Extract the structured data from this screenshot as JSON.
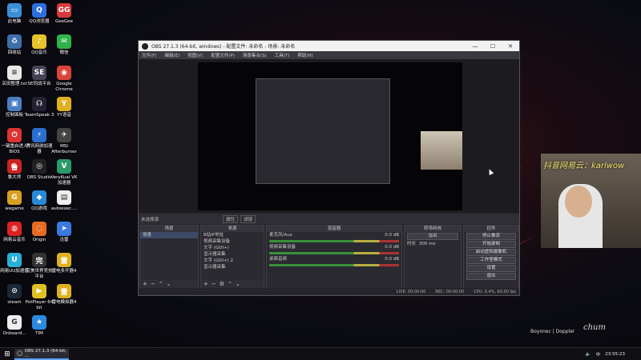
{
  "desktop": {
    "icons": [
      {
        "label": "此电脑",
        "glyph": "▭",
        "color": "#3b8fd9"
      },
      {
        "label": "QQ浏览器",
        "glyph": "Q",
        "color": "#2b6fe0"
      },
      {
        "label": "GeeGee",
        "glyph": "GG",
        "color": "#d93a3a"
      },
      {
        "label": "回收站",
        "glyph": "♻",
        "color": "#3d6fa8"
      },
      {
        "label": "QQ音乐",
        "glyph": "♪",
        "color": "#e6c22b"
      },
      {
        "label": "微信",
        "glyph": "✉",
        "color": "#2fb34a"
      },
      {
        "label": "买田整理.txt",
        "glyph": "≡",
        "color": "#e8e8e8"
      },
      {
        "label": "SE同战平台",
        "glyph": "SE",
        "color": "#445"
      },
      {
        "label": "Google Chrome",
        "glyph": "◉",
        "color": "#d9453a"
      },
      {
        "label": "控制面板",
        "glyph": "▣",
        "color": "#4a7ec2"
      },
      {
        "label": "TeamSpeak 3",
        "glyph": "☊",
        "color": "#223"
      },
      {
        "label": "YY语音",
        "glyph": "Y",
        "color": "#e0b020"
      },
      {
        "label": "一键重启进入BIOS",
        "glyph": "⏻",
        "color": "#d33"
      },
      {
        "label": "腾讯网游加速器",
        "glyph": "⚡",
        "color": "#2a6fd0"
      },
      {
        "label": "MSI Afterburner",
        "glyph": "✈",
        "color": "#444"
      },
      {
        "label": "鲁大师",
        "glyph": "鲁",
        "color": "#c22"
      },
      {
        "label": "OBS Studio",
        "glyph": "◎",
        "color": "#222"
      },
      {
        "label": "VeryKuai VK加速器",
        "glyph": "V",
        "color": "#2a9a6a"
      },
      {
        "label": "wegame",
        "glyph": "G",
        "color": "#d8a020"
      },
      {
        "label": "QQ游戏",
        "glyph": "◆",
        "color": "#2a8ad8"
      },
      {
        "label": "autoexec....",
        "glyph": "▤",
        "color": "#eee"
      },
      {
        "label": "网易云音乐",
        "glyph": "◍",
        "color": "#d22"
      },
      {
        "label": "Origin",
        "glyph": "◌",
        "color": "#e66a20"
      },
      {
        "label": "迅雷",
        "glyph": "➤",
        "color": "#3a7ae0"
      },
      {
        "label": "网易UU加速器",
        "glyph": "U",
        "color": "#2ab0d8"
      },
      {
        "label": "完美世界竞技平台",
        "glyph": "完",
        "color": "#333"
      },
      {
        "label": "雷电多开器4",
        "glyph": "雷",
        "color": "#e0b020"
      },
      {
        "label": "steam",
        "glyph": "⊙",
        "color": "#1b2838"
      },
      {
        "label": "PotPlayer 64 bit",
        "glyph": "▶",
        "color": "#e0c020"
      },
      {
        "label": "雷电模拟器4",
        "glyph": "雷",
        "color": "#e0b020"
      },
      {
        "label": "Onboard...",
        "glyph": "G",
        "color": "#eee"
      },
      {
        "label": "TIM",
        "glyph": "★",
        "color": "#2a8ae0"
      }
    ]
  },
  "obs": {
    "title": "OBS 27.1.3 (64-bit, windows) - 配置文件: 未命名 - 场景: 未命名",
    "window_controls": [
      "—",
      "☐",
      "✕"
    ],
    "menu": [
      "文件(F)",
      "编辑(E)",
      "视图(V)",
      "配置文件(P)",
      "场景集合(S)",
      "工具(T)",
      "帮助(H)"
    ],
    "info_bar": {
      "label": "未选择源",
      "properties": "属性",
      "filters": "滤镜"
    },
    "scenes": {
      "header": "场景",
      "items": [
        "场景"
      ]
    },
    "sources": {
      "header": "来源",
      "items": [
        "B站IP地址",
        "视频采集设备",
        "文字 (GDI+)",
        "显示器采集",
        "文字 (GDI+) 2",
        "显示器采集"
      ]
    },
    "mixer": {
      "header": "混音器",
      "channels": [
        {
          "name": "麦克风/Aux",
          "db": "0.0 dB"
        },
        {
          "name": "视频采集设备",
          "db": "0.0 dB"
        },
        {
          "name": "桌面音频",
          "db": "0.0 dB"
        }
      ]
    },
    "transitions": {
      "header": "转场特效",
      "type": "淡出",
      "duration_label": "时长",
      "duration": "300 ms"
    },
    "controls": {
      "header": "控件",
      "buttons": [
        "停止推流",
        "开始录制",
        "启动虚拟摄像机",
        "工作室模式",
        "设置",
        "退出"
      ]
    },
    "status": {
      "live": "LIVE: 00:00:00",
      "rec": "REC: 00:00:00",
      "cpu": "CPU: 0.4%, 60.00 fps"
    }
  },
  "overlay": {
    "text": "抖音网易云：karlwow",
    "signature": "Boyonec | Doppler",
    "mark": "chum"
  },
  "taskbar": {
    "start_glyph": "⊞",
    "task_label": "OBS 27.1.3 (64-bit, ...",
    "tray_lang": "中",
    "tray_time": "23:55:23"
  }
}
